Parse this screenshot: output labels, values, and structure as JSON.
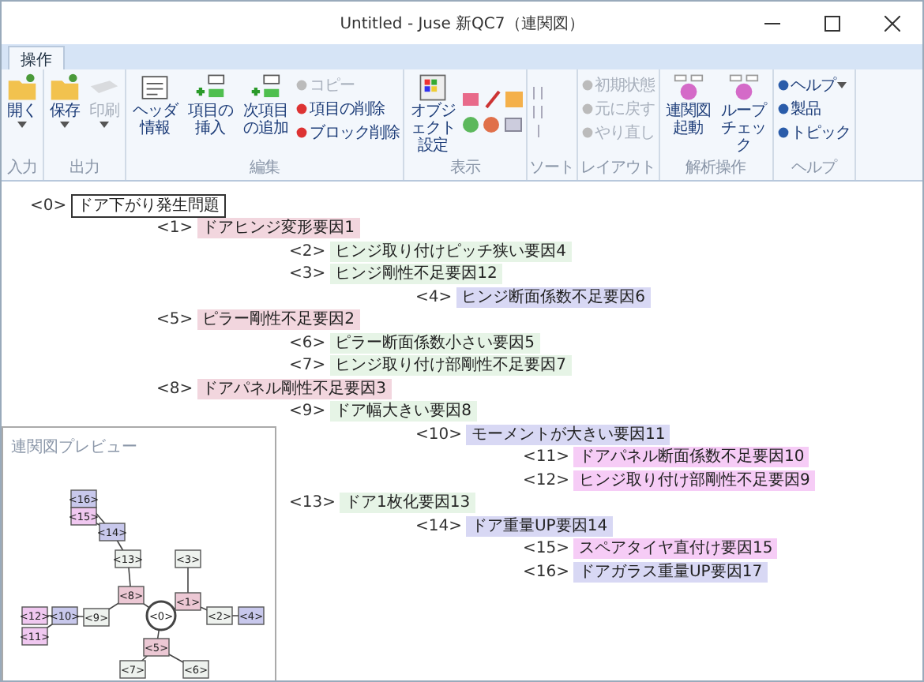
{
  "window": {
    "title": "Untitled - Juse 新QC7（連関図）"
  },
  "tabs": [
    {
      "label": "操作",
      "selected": true
    }
  ],
  "ribbon": [
    {
      "label": "入力",
      "items": [
        {
          "label": "開く",
          "kind": "large",
          "disabled": false,
          "dropdown": true
        }
      ]
    },
    {
      "label": "出力",
      "items": [
        {
          "label": "保存",
          "kind": "large",
          "disabled": false,
          "dropdown": true
        },
        {
          "label": "印刷",
          "kind": "large",
          "disabled": true,
          "dropdown": true
        }
      ]
    },
    {
      "label": "編集",
      "items": [
        {
          "label": "ヘッダ情報",
          "kind": "large",
          "disabled": false,
          "dropdown": false
        },
        {
          "label": "項目の挿入",
          "kind": "large",
          "disabled": false,
          "dropdown": false
        },
        {
          "label": "次項目の追加",
          "kind": "large",
          "disabled": false,
          "dropdown": false
        },
        {
          "label": "コピー",
          "kind": "small",
          "disabled": true,
          "dropdown": false
        },
        {
          "label": "項目の削除",
          "kind": "small",
          "disabled": false,
          "dropdown": false
        },
        {
          "label": "ブロック削除",
          "kind": "small",
          "disabled": false,
          "dropdown": false
        }
      ]
    },
    {
      "label": "表示",
      "items": [
        {
          "label": "オブジェクト設定",
          "kind": "large",
          "disabled": false,
          "dropdown": false
        },
        {
          "kind": "tools"
        }
      ]
    },
    {
      "label": "ソート",
      "items": [
        {
          "kind": "sort",
          "disabled": true
        }
      ]
    },
    {
      "label": "レイアウト",
      "items": [
        {
          "label": "初期状態",
          "kind": "small",
          "disabled": true,
          "dropdown": false
        },
        {
          "label": "元に戻す",
          "kind": "small",
          "disabled": true,
          "dropdown": false
        },
        {
          "label": "やり直し",
          "kind": "small",
          "disabled": true,
          "dropdown": false
        }
      ]
    },
    {
      "label": "解析操作",
      "items": [
        {
          "label": "連関図起動",
          "kind": "large",
          "disabled": false,
          "dropdown": false
        },
        {
          "label": "ループチェック",
          "kind": "large",
          "disabled": false,
          "dropdown": false
        }
      ]
    },
    {
      "label": "ヘルプ",
      "items": [
        {
          "label": "ヘルプ",
          "kind": "small",
          "disabled": false,
          "dropdown": true
        },
        {
          "label": "製品",
          "kind": "small",
          "disabled": false,
          "dropdown": false
        },
        {
          "label": "トピック",
          "kind": "small",
          "disabled": false,
          "dropdown": false
        }
      ]
    }
  ],
  "tree": [
    {
      "number": "<0>",
      "text": "ドア下がり発生問題",
      "selected": true,
      "children": [
        {
          "number": "<1>",
          "text": "ドアヒンジ変形要因1",
          "color": "#f2d6de",
          "selected": false,
          "children": [
            {
              "number": "<2>",
              "text": "ヒンジ取り付けピッチ狭い要因4",
              "color": "#e6f4e6",
              "selected": false
            },
            {
              "number": "<3>",
              "text": "ヒンジ剛性不足要因12",
              "color": "#e6f4e6",
              "selected": false,
              "children": [
                {
                  "number": "<4>",
                  "text": "ヒンジ断面係数不足要因6",
                  "color": "#d8d8f4",
                  "selected": false
                }
              ]
            }
          ]
        },
        {
          "number": "<5>",
          "text": "ピラー剛性不足要因2",
          "color": "#f2d6de",
          "selected": false,
          "children": [
            {
              "number": "<6>",
              "text": "ピラー断面係数小さい要因5",
              "color": "#e6f4e6",
              "selected": false
            },
            {
              "number": "<7>",
              "text": "ヒンジ取り付け部剛性不足要因7",
              "color": "#e6f4e6",
              "selected": false
            }
          ]
        },
        {
          "number": "<8>",
          "text": "ドアパネル剛性不足要因3",
          "color": "#f2d6de",
          "selected": false,
          "children": [
            {
              "number": "<9>",
              "text": "ドア幅大きい要因8",
              "color": "#e6f4e6",
              "selected": false,
              "children": [
                {
                  "number": "<10>",
                  "text": "モーメントが大きい要因11",
                  "color": "#d8d8f4",
                  "selected": false,
                  "children": [
                    {
                      "number": "<11>",
                      "text": "ドアパネル断面係数不足要因10",
                      "color": "#f6ccf6",
                      "selected": false
                    },
                    {
                      "number": "<12>",
                      "text": "ヒンジ取り付け部剛性不足要因9",
                      "color": "#f6ccf6",
                      "selected": false
                    }
                  ]
                }
              ]
            },
            {
              "number": "<13>",
              "text": "ドア1枚化要因13",
              "color": "#e6f4e6",
              "selected": false,
              "children": [
                {
                  "number": "<14>",
                  "text": "ドア重量UP要因14",
                  "color": "#d8d8f4",
                  "selected": false,
                  "children": [
                    {
                      "number": "<15>",
                      "text": "スペアタイヤ直付け要因15",
                      "color": "#f6ccf6",
                      "selected": false
                    },
                    {
                      "number": "<16>",
                      "text": "ドアガラス重量UP要因17",
                      "color": "#d8d8f4",
                      "selected": false
                    }
                  ]
                }
              ]
            }
          ]
        }
      ]
    }
  ],
  "preview": {
    "title": "連関図プレビュー",
    "nodes": [
      {
        "label": "<0>",
        "kind": "root",
        "children": [
          {
            "label": "<1>",
            "color": "#ecc8d4",
            "children": [
              {
                "label": "<2>",
                "color": "#eef2ee",
                "children": [
                  {
                    "label": "<4>",
                    "color": "#c8c8ec"
                  }
                ]
              },
              {
                "label": "<3>",
                "color": "#eef2ee"
              }
            ]
          },
          {
            "label": "<5>",
            "color": "#ecc8d4",
            "children": [
              {
                "label": "<7>",
                "color": "#eef2ee"
              },
              {
                "label": "<6>",
                "color": "#eef2ee"
              }
            ]
          },
          {
            "label": "<8>",
            "color": "#ecc8d4",
            "children": [
              {
                "label": "<13>",
                "color": "#eef2ee",
                "children": [
                  {
                    "label": "<14>",
                    "color": "#c8c8ec",
                    "children": [
                      {
                        "label": "<16>",
                        "color": "#c8c8ec"
                      },
                      {
                        "label": "<15>",
                        "color": "#f0c8f0"
                      }
                    ]
                  }
                ]
              },
              {
                "label": "<9>",
                "color": "#eef2ee",
                "children": [
                  {
                    "label": "<10>",
                    "color": "#c8c8ec",
                    "children": [
                      {
                        "label": "<12>",
                        "color": "#f0c8f0"
                      },
                      {
                        "label": "<11>",
                        "color": "#f0c8f0"
                      }
                    ]
                  }
                ]
              }
            ]
          }
        ]
      }
    ]
  }
}
